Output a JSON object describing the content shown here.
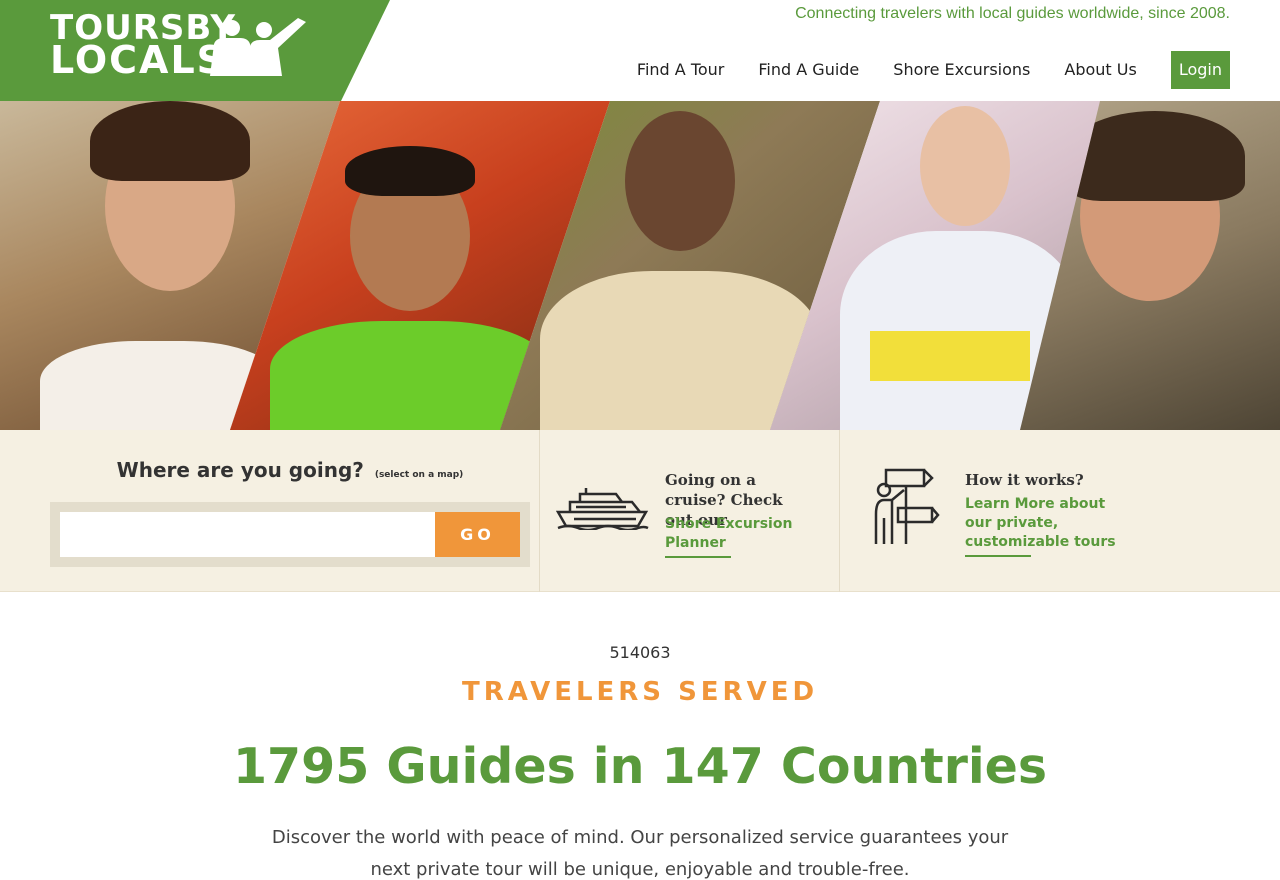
{
  "header": {
    "logo_line1": "TOURSBY",
    "logo_line2": "LOCALS",
    "tagline": "Connecting travelers with local guides worldwide, since 2008.",
    "nav": [
      "Find A Tour",
      "Find A Guide",
      "Shore Excursions",
      "About Us"
    ],
    "login_label": "Login",
    "brand_color": "#5a9a3c"
  },
  "search": {
    "title": "Where are you going?",
    "hint": "(select on a map)",
    "input_value": "",
    "placeholder": "",
    "go_label": "GO",
    "accent_color": "#f0963a"
  },
  "cruise": {
    "heading": "Going on a cruise? Check out our",
    "link": "Shore Excursion Planner",
    "icon": "cruise-ship-icon"
  },
  "how": {
    "heading": "How it works?",
    "link": "Learn More about our private, customizable tours",
    "icon": "guide-signpost-icon"
  },
  "stats": {
    "travelers_count": "514063",
    "travelers_label": "TRAVELERS SERVED",
    "guides_line": "1795 Guides in 147 Countries",
    "description": "Discover the world with peace of mind. Our personalized service guarantees your next private tour will be unique, enjoyable and trouble-free."
  }
}
